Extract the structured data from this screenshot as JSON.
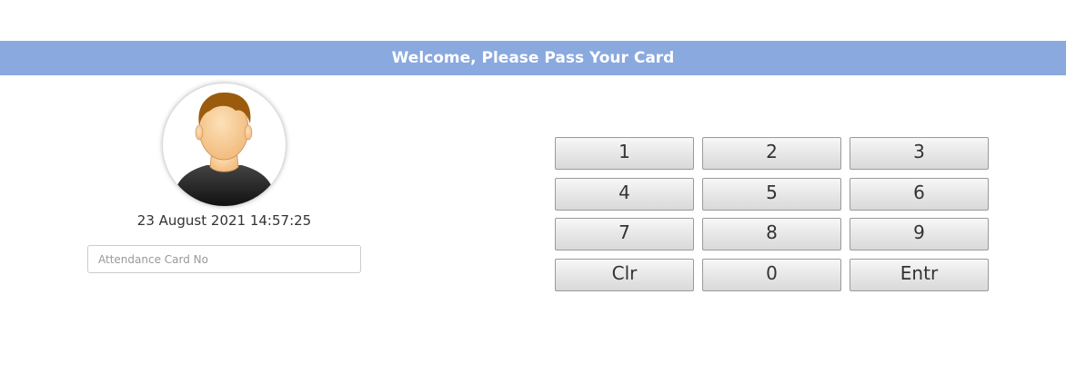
{
  "header": {
    "title": "Welcome, Please Pass Your Card",
    "background_color": "#8aa9df"
  },
  "profile": {
    "avatar_icon": "user-avatar-icon",
    "datetime": "23 August 2021 14:57:25"
  },
  "card_input": {
    "placeholder": "Attendance Card No",
    "value": ""
  },
  "keypad": {
    "k1": "1",
    "k2": "2",
    "k3": "3",
    "k4": "4",
    "k5": "5",
    "k6": "6",
    "k7": "7",
    "k8": "8",
    "k9": "9",
    "clear": "Clr",
    "k0": "0",
    "enter": "Entr"
  }
}
